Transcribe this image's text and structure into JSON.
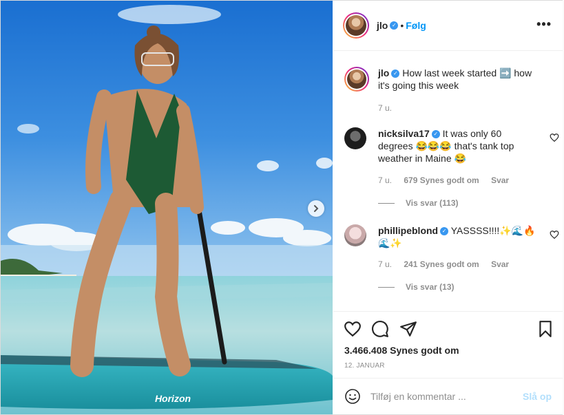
{
  "post": {
    "username": "jlo",
    "follow_label": "Følg",
    "dot": "•",
    "more_icon": "more-icon"
  },
  "caption": {
    "username": "jlo",
    "text": "How last week started ➡️ how it's going this week",
    "time": "7 u."
  },
  "comments": [
    {
      "username": "nicksilva17",
      "text": "It was only 60 degrees 😂😂😂 that's tank top weather in Maine 😂",
      "time": "7 u.",
      "likes": "679 Synes godt om",
      "reply_label": "Svar",
      "view_replies": "Vis svar (113)"
    },
    {
      "username": "phillipeblond",
      "text": "YASSSS!!!!✨🌊🔥🌊✨",
      "time": "7 u.",
      "likes": "241 Synes godt om",
      "reply_label": "Svar",
      "view_replies": "Vis svar (13)"
    }
  ],
  "actions": {
    "likes": "3.466.408 Synes godt om",
    "date": "12. JANUAR"
  },
  "add_comment": {
    "placeholder": "Tilføj en kommentar ...",
    "post_label": "Slå op"
  },
  "photo": {
    "board_text": "Horizon"
  },
  "colors": {
    "link_blue": "#0095f6",
    "verified_blue": "#3897f0",
    "muted": "#8e8e8e",
    "post_disabled": "#b2dffc"
  }
}
